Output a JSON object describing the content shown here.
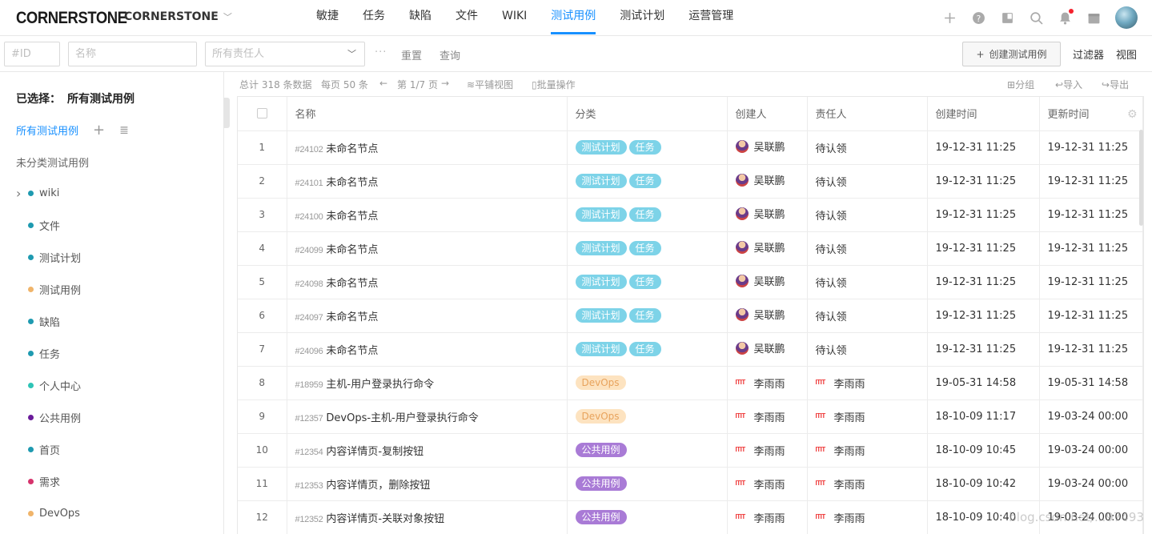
{
  "app": {
    "logo": "CORNERSTONE",
    "project": "CORNERSTONE"
  },
  "nav": {
    "items": [
      "敏捷",
      "任务",
      "缺陷",
      "文件",
      "WIKI",
      "测试用例",
      "测试计划",
      "运营管理"
    ],
    "active_index": 5
  },
  "icons": [
    "plus-icon",
    "help-icon",
    "book-icon",
    "search-icon",
    "bell-icon",
    "calendar-icon"
  ],
  "filters": {
    "id_placeholder": "#ID",
    "name_placeholder": "名称",
    "assignee_placeholder": "所有责任人",
    "more": "···",
    "reset": "重置",
    "query": "查询",
    "create": "创建测试用例",
    "filter": "过滤器",
    "view": "视图"
  },
  "sidebar": {
    "selected_prefix": "已选择：",
    "selected_value": "所有测试用例",
    "all_label": "所有测试用例",
    "uncategorized": "未分类测试用例",
    "tree": [
      {
        "label": "wiki",
        "color": "#1e9ab0",
        "expandable": true
      },
      {
        "label": "文件",
        "color": "#1e9ab0"
      },
      {
        "label": "测试计划",
        "color": "#1e9ab0"
      },
      {
        "label": "测试用例",
        "color": "#f0b46a"
      },
      {
        "label": "缺陷",
        "color": "#1e9ab0"
      },
      {
        "label": "任务",
        "color": "#1e9ab0"
      },
      {
        "label": "个人中心",
        "color": "#2ec4b6"
      },
      {
        "label": "公共用例",
        "color": "#6a1b9a"
      },
      {
        "label": "首页",
        "color": "#1e9ab0"
      },
      {
        "label": "需求",
        "color": "#d6336c"
      },
      {
        "label": "DevOps",
        "color": "#f0b46a"
      }
    ]
  },
  "toolbar": {
    "total": "总计 318 条数据",
    "per_page": "每页 50 条",
    "page": "第 1/7 页",
    "tile_view": "平铺视图",
    "batch": "批量操作",
    "group": "分组",
    "import": "导入",
    "export": "导出"
  },
  "table": {
    "columns": [
      "名称",
      "分类",
      "创建人",
      "责任人",
      "创建时间",
      "更新时间"
    ],
    "rows": [
      {
        "no": "1",
        "id": "#24102",
        "name": "未命名节点",
        "tags": [
          "测试计划",
          "任务"
        ],
        "creator": "吴联鹏",
        "creator_av": "wu",
        "owner": "待认领",
        "owner_av": "",
        "created": "19-12-31 11:25",
        "updated": "19-12-31 11:25"
      },
      {
        "no": "2",
        "id": "#24101",
        "name": "未命名节点",
        "tags": [
          "测试计划",
          "任务"
        ],
        "creator": "吴联鹏",
        "creator_av": "wu",
        "owner": "待认领",
        "owner_av": "",
        "created": "19-12-31 11:25",
        "updated": "19-12-31 11:25"
      },
      {
        "no": "3",
        "id": "#24100",
        "name": "未命名节点",
        "tags": [
          "测试计划",
          "任务"
        ],
        "creator": "吴联鹏",
        "creator_av": "wu",
        "owner": "待认领",
        "owner_av": "",
        "created": "19-12-31 11:25",
        "updated": "19-12-31 11:25"
      },
      {
        "no": "4",
        "id": "#24099",
        "name": "未命名节点",
        "tags": [
          "测试计划",
          "任务"
        ],
        "creator": "吴联鹏",
        "creator_av": "wu",
        "owner": "待认领",
        "owner_av": "",
        "created": "19-12-31 11:25",
        "updated": "19-12-31 11:25"
      },
      {
        "no": "5",
        "id": "#24098",
        "name": "未命名节点",
        "tags": [
          "测试计划",
          "任务"
        ],
        "creator": "吴联鹏",
        "creator_av": "wu",
        "owner": "待认领",
        "owner_av": "",
        "created": "19-12-31 11:25",
        "updated": "19-12-31 11:25"
      },
      {
        "no": "6",
        "id": "#24097",
        "name": "未命名节点",
        "tags": [
          "测试计划",
          "任务"
        ],
        "creator": "吴联鹏",
        "creator_av": "wu",
        "owner": "待认领",
        "owner_av": "",
        "created": "19-12-31 11:25",
        "updated": "19-12-31 11:25"
      },
      {
        "no": "7",
        "id": "#24096",
        "name": "未命名节点",
        "tags": [
          "测试计划",
          "任务"
        ],
        "creator": "吴联鹏",
        "creator_av": "wu",
        "owner": "待认领",
        "owner_av": "",
        "created": "19-12-31 11:25",
        "updated": "19-12-31 11:25"
      },
      {
        "no": "8",
        "id": "#18959",
        "name": "主机-用户登录执行命令",
        "tags": [
          "DevOps"
        ],
        "creator": "李雨雨",
        "creator_av": "li",
        "owner": "李雨雨",
        "owner_av": "li",
        "created": "19-05-31 14:58",
        "updated": "19-05-31 14:58"
      },
      {
        "no": "9",
        "id": "#12357",
        "name": "DevOps-主机-用户登录执行命令",
        "tags": [
          "DevOps"
        ],
        "creator": "李雨雨",
        "creator_av": "li",
        "owner": "李雨雨",
        "owner_av": "li",
        "created": "18-10-09 11:17",
        "updated": "19-03-24 00:00"
      },
      {
        "no": "10",
        "id": "#12354",
        "name": "内容详情页-复制按钮",
        "tags": [
          "公共用例"
        ],
        "creator": "李雨雨",
        "creator_av": "li",
        "owner": "李雨雨",
        "owner_av": "li",
        "created": "18-10-09 10:45",
        "updated": "19-03-24 00:00"
      },
      {
        "no": "11",
        "id": "#12353",
        "name": "内容详情页，删除按钮",
        "tags": [
          "公共用例"
        ],
        "creator": "李雨雨",
        "creator_av": "li",
        "owner": "李雨雨",
        "owner_av": "li",
        "created": "18-10-09 10:42",
        "updated": "19-03-24 00:00"
      },
      {
        "no": "12",
        "id": "#12352",
        "name": "内容详情页-关联对象按钮",
        "tags": [
          "公共用例"
        ],
        "creator": "李雨雨",
        "creator_av": "li",
        "owner": "李雨雨",
        "owner_av": "li",
        "created": "18-10-09 10:40",
        "updated": "19-03-24 00:00"
      }
    ]
  },
  "tag_styles": {
    "测试计划": "tag-testplan",
    "任务": "tag-task",
    "DevOps": "tag-devops",
    "公共用例": "tag-public"
  },
  "watermark": "blog.csdn.net/...97493"
}
